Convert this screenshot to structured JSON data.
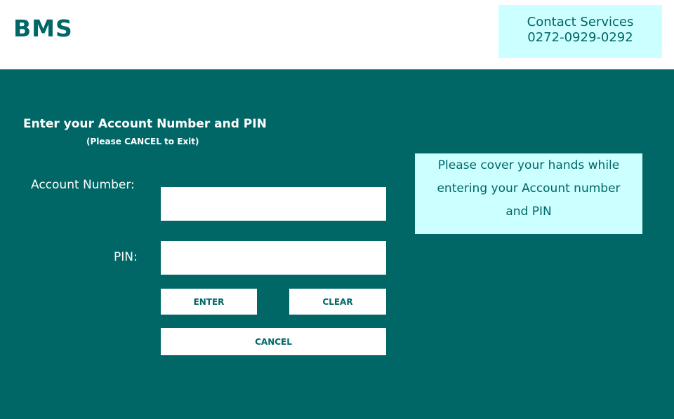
{
  "header": {
    "logo": "BMS",
    "contact_title": "Contact Services",
    "contact_phone": "0272-0929-0292"
  },
  "form": {
    "title": "Enter your Account Number and PIN",
    "subtitle": "(Please CANCEL to Exit)",
    "account_label": "Account Number:",
    "account_value": "",
    "pin_label": "PIN:",
    "pin_value": ""
  },
  "buttons": {
    "enter": "ENTER",
    "clear": "CLEAR",
    "cancel": "CANCEL"
  },
  "notice": {
    "lines": [
      "Please cover your hands while",
      "entering your Account number",
      "and PIN"
    ]
  },
  "colors": {
    "primary": "#006666",
    "accent_panel": "#ccffff",
    "background_header": "#ffffff"
  }
}
